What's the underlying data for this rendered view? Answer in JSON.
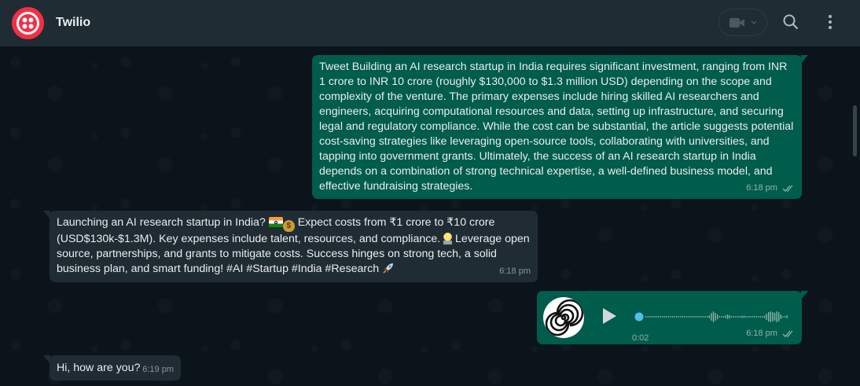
{
  "header": {
    "contact_name": "Twilio",
    "avatar_icon": "twilio-logo-icon",
    "video_icon": "video-camera-icon",
    "search_icon": "search-icon",
    "menu_icon": "more-vertical-icon"
  },
  "colors": {
    "header_bg": "#202c33",
    "chat_bg": "#0b141a",
    "outgoing_bubble": "#005c4b",
    "incoming_bubble": "#202c33",
    "avatar": "#f22f46",
    "read_tick": "#8fb3aa",
    "voice_progress": "#53bdeb"
  },
  "messages": [
    {
      "direction": "outgoing",
      "text": "Tweet Building an AI research startup in India requires significant investment, ranging from INR 1 crore to INR 10 crore (roughly $130,000 to $1.3 million USD) depending on the scope and complexity of the venture. The primary expenses include hiring skilled AI researchers and engineers, acquiring computational resources and data, setting up infrastructure, and securing legal and regulatory compliance.  While the cost can be substantial, the article suggests potential cost-saving strategies like leveraging open-source tools, collaborating with universities, and tapping into government grants.  Ultimately, the success of an AI research startup in India depends on a combination of strong technical expertise, a well-defined business model, and effective fundraising strategies.",
      "time": "6:18 pm",
      "status_icon": "double-check-icon"
    },
    {
      "direction": "incoming",
      "text_part1": "Launching an AI research startup in India? ",
      "text_part2": " Expect costs from ₹1 crore to ₹10 crore (USD$130k-$1.3M). Key expenses include talent, resources, and compliance. ",
      "text_part3": " Leverage open source, partnerships, and grants to mitigate costs. Success hinges on strong tech, a solid business plan, and smart funding! #AI #Startup #India #Research ",
      "emojis": [
        "india-flag-icon",
        "money-bag-icon",
        "light-bulb-icon",
        "rocket-icon"
      ],
      "time": "6:18 pm"
    },
    {
      "direction": "outgoing",
      "type": "voice",
      "duration": "0:02",
      "progress": 0,
      "time": "6:18 pm",
      "avatar_icon": "spiral-icon",
      "play_icon": "play-icon",
      "status_icon": "double-check-icon"
    },
    {
      "direction": "incoming",
      "text": "Hi, how are you?",
      "time": "6:19 pm"
    }
  ]
}
